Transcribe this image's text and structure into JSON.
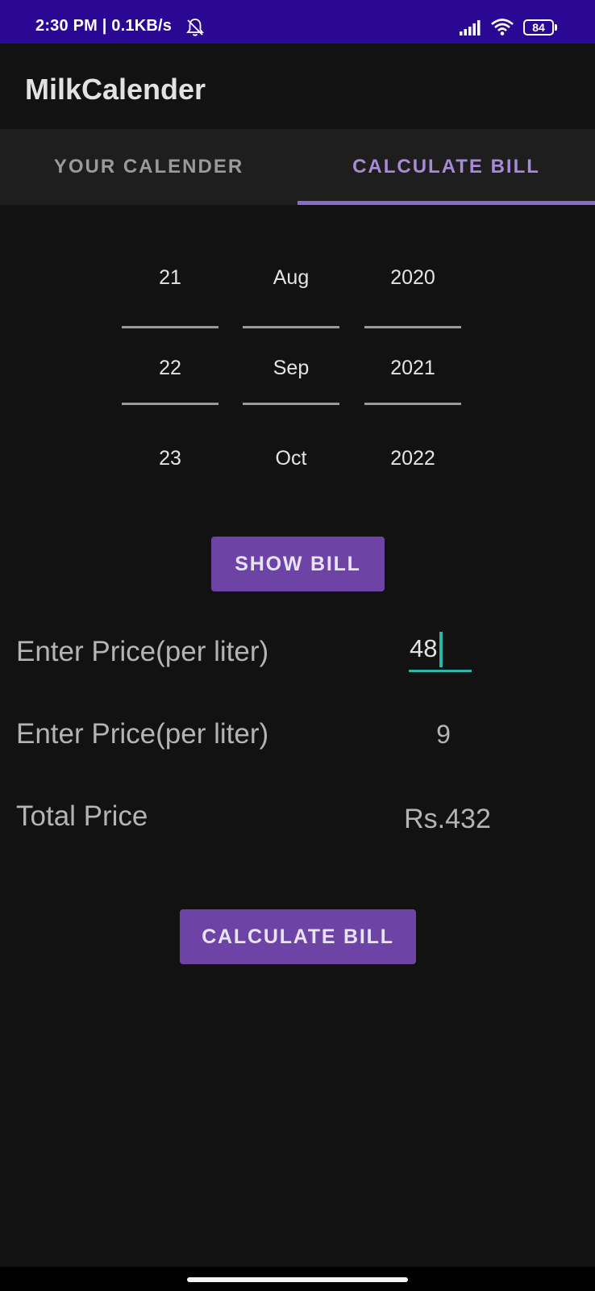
{
  "status_bar": {
    "time": "2:30 PM | 0.1KB/s",
    "bell_icon": "bell-off-icon",
    "signal_icon": "cellular-signal-icon",
    "wifi_icon": "wifi-icon",
    "battery_level": "84",
    "background_color": "#2a0894"
  },
  "app_bar": {
    "title": "MilkCalender"
  },
  "tabs": [
    {
      "label": "YOUR CALENDER",
      "selected": false
    },
    {
      "label": "CALCULATE BILL",
      "selected": true
    }
  ],
  "tab_accent_color": "#8c6bc8",
  "date_picker": {
    "day": {
      "prev": "21",
      "current": "22",
      "next": "23"
    },
    "month": {
      "prev": "Aug",
      "current": "Sep",
      "next": "Oct"
    },
    "year": {
      "prev": "2020",
      "current": "2021",
      "next": "2022"
    }
  },
  "buttons": {
    "show_bill": "SHOW BILL",
    "calculate_bill": "CALCULATE BILL",
    "color": "#6d44a6"
  },
  "bill": {
    "price_label": "Enter Price(per liter)",
    "price_value": "48",
    "quantity_label": "Enter Price(per liter)",
    "quantity_value": "9",
    "total_label": "Total Price",
    "total_value": "Rs.432"
  },
  "input_accent_color": "#2bb5a6"
}
